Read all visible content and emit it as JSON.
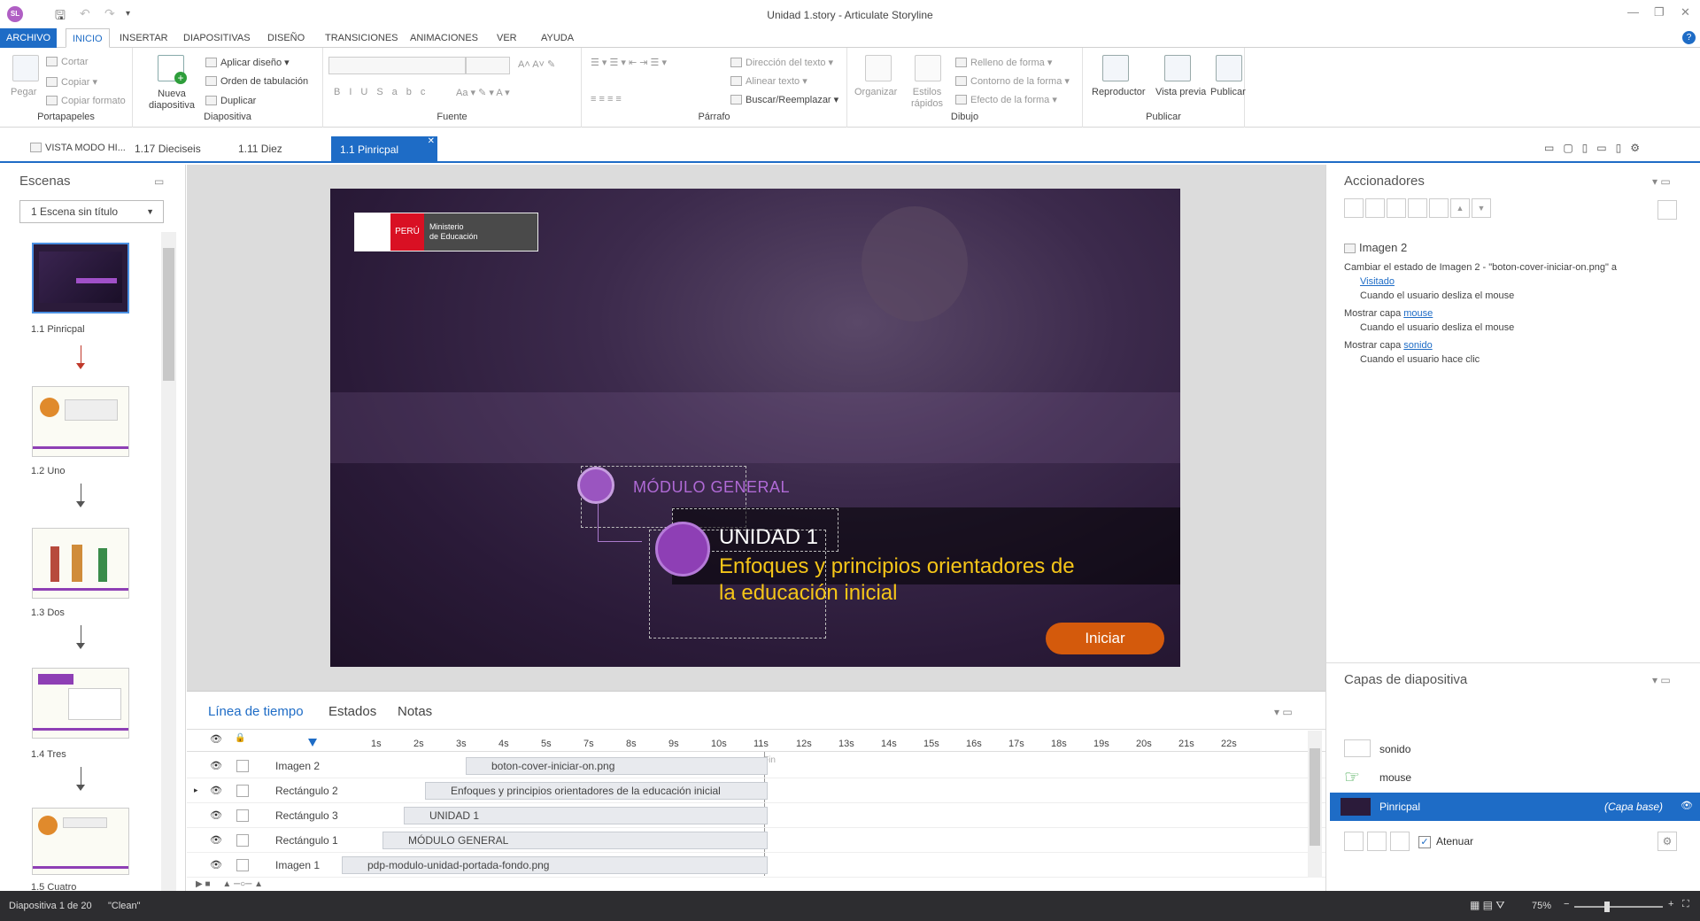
{
  "app": {
    "title": "Unidad 1.story - Articulate Storyline",
    "logo": "SL"
  },
  "ribbon_tabs": [
    "ARCHIVO",
    "INICIO",
    "INSERTAR",
    "DIAPOSITIVAS",
    "DISEÑO",
    "TRANSICIONES",
    "ANIMACIONES",
    "VER",
    "AYUDA"
  ],
  "ribbon": {
    "portapapeles": {
      "paste": "Pegar",
      "cut": "Cortar",
      "copy": "Copiar",
      "format": "Copiar formato",
      "label": "Portapapeles"
    },
    "diapositiva": {
      "new": "Nueva diapositiva",
      "apply": "Aplicar diseño",
      "tab_order": "Orden de tabulación",
      "duplicate": "Duplicar",
      "label": "Diapositiva"
    },
    "fuente": {
      "label": "Fuente"
    },
    "parrafo": {
      "dir": "Dirección del texto",
      "align": "Alinear texto",
      "find": "Buscar/Reemplazar",
      "label": "Párrafo"
    },
    "dibujo": {
      "organize": "Organizar",
      "styles": "Estilos rápidos",
      "fill": "Relleno de forma",
      "outline": "Contorno de la forma",
      "effect": "Efecto de la forma",
      "label": "Dibujo"
    },
    "publicar": {
      "player": "Reproductor",
      "preview": "Vista previa",
      "publish": "Publicar",
      "label": "Publicar"
    }
  },
  "doc_tabs": [
    {
      "label": "VISTA MODO HI..."
    },
    {
      "label": "1.17 Dieciseis"
    },
    {
      "label": "1.11 Diez"
    },
    {
      "label": "1.1 Pinricpal"
    }
  ],
  "scenes": {
    "title": "Escenas",
    "dropdown": "1 Escena sin título",
    "slides": [
      {
        "label": "1.1 Pinricpal"
      },
      {
        "label": "1.2 Uno"
      },
      {
        "label": "1.3 Dos"
      },
      {
        "label": "1.4 Tres"
      },
      {
        "label": "1.5 Cuatro"
      }
    ]
  },
  "slide": {
    "peru": "PERÚ",
    "ministerio_1": "Ministerio",
    "ministerio_2": "de Educación",
    "modulo": "MÓDULO GENERAL",
    "unidad": "UNIDAD 1",
    "subtitle_1": "Enfoques y principios orientadores de",
    "subtitle_2": "la educación inicial",
    "button": "Iniciar"
  },
  "timeline": {
    "tabs": [
      "Línea de tiempo",
      "Estados",
      "Notas"
    ],
    "ticks": [
      "1s",
      "2s",
      "3s",
      "4s",
      "5s",
      "7s",
      "8s",
      "9s",
      "10s",
      "11s",
      "12s",
      "13s",
      "14s",
      "15s",
      "16s",
      "17s",
      "18s",
      "19s",
      "20s",
      "21s",
      "22s"
    ],
    "end_label": "Fin",
    "rows": [
      {
        "name": "Imagen 2",
        "bar": "boton-cover-iniciar-on.png"
      },
      {
        "name": "Rectángulo 2",
        "bar": "Enfoques y principios orientadores de la educación inicial"
      },
      {
        "name": "Rectángulo 3",
        "bar": "UNIDAD 1"
      },
      {
        "name": "Rectángulo 1",
        "bar": "MÓDULO GENERAL"
      },
      {
        "name": "Imagen 1",
        "bar": "pdp-modulo-unidad-portada-fondo.png"
      }
    ]
  },
  "triggers": {
    "title": "Accionadores",
    "object": "Imagen 2",
    "t1": "Cambiar el estado de Imagen 2 - \"boton-cover-iniciar-on.png\" a",
    "t1_link": "Visitado",
    "t1_when": "Cuando el usuario desliza el mouse",
    "t2": "Mostrar capa",
    "t2_link": "mouse",
    "t2_when": "Cuando el usuario desliza el mouse",
    "t3": "Mostrar capa",
    "t3_link": "sonido",
    "t3_when": "Cuando el usuario hace clic"
  },
  "layers": {
    "title": "Capas de diapositiva",
    "items": [
      {
        "name": "sonido"
      },
      {
        "name": "mouse"
      },
      {
        "name": "Pinricpal",
        "tag": "(Capa base)"
      }
    ],
    "dim_label": "Atenuar"
  },
  "status": {
    "slide": "Diapositiva 1 de 20",
    "theme": "\"Clean\"",
    "zoom": "75%"
  },
  "colors": {
    "accent": "#1e6cc6",
    "slide_purple": "#8e3fb5",
    "subtitle_yellow": "#f5c518",
    "button_orange": "#d45a0c"
  }
}
